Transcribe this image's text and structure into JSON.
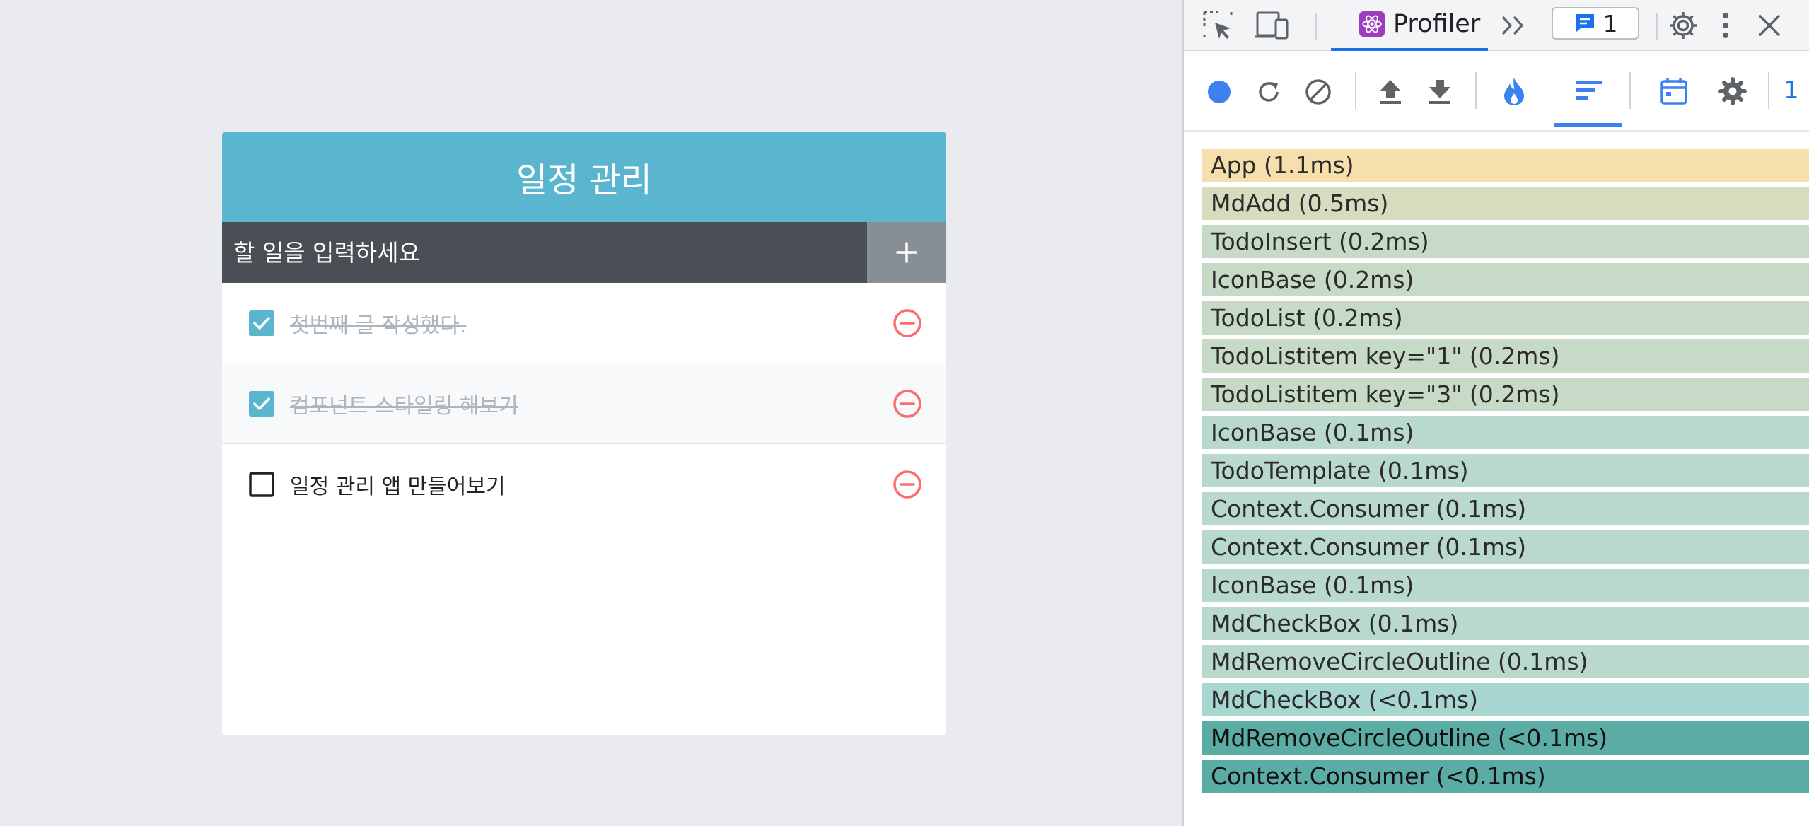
{
  "app": {
    "title": "일정 관리",
    "input_placeholder": "할 일을 입력하세요",
    "add_icon": "plus-icon",
    "todos": [
      {
        "text": "첫번째 글 작성했다.",
        "checked": true
      },
      {
        "text": "컴포넌트 스타일링 해보기",
        "checked": true
      },
      {
        "text": "일정 관리 앱 만들어보기",
        "checked": false
      }
    ],
    "colors": {
      "header": "#5ab5cf",
      "insert_bg": "#4a4f56",
      "add_button": "#868e96",
      "check": "#5ab5cf",
      "remove": "#ff6b6b"
    }
  },
  "devtools": {
    "active_tab": "Profiler",
    "issues_count": "1",
    "toolbar_overflow_label": "1",
    "icons": [
      "inspect-element-icon",
      "device-toggle-icon",
      "react-logo-icon",
      "more-tabs-icon",
      "issues-icon",
      "settings-icon",
      "kebab-menu-icon",
      "close-icon"
    ],
    "profiler_toolbar_icons": [
      "record-icon",
      "reload-and-profile-icon",
      "clear-icon",
      "upload-icon",
      "download-icon",
      "flamegraph-icon",
      "ranked-chart-icon",
      "timeline-icon",
      "profiler-settings-icon"
    ],
    "ranked_rows": [
      {
        "label": "App (1.1ms)",
        "color": "#f7dfad"
      },
      {
        "label": "MdAdd (0.5ms)",
        "color": "#d8dcbf"
      },
      {
        "label": "TodoInsert (0.2ms)",
        "color": "#c7dac7"
      },
      {
        "label": "IconBase (0.2ms)",
        "color": "#c7dac7"
      },
      {
        "label": "TodoList (0.2ms)",
        "color": "#c7dac7"
      },
      {
        "label": "TodoListitem key=\"1\" (0.2ms)",
        "color": "#c7dac7"
      },
      {
        "label": "TodoListitem key=\"3\" (0.2ms)",
        "color": "#c7dac7"
      },
      {
        "label": "IconBase (0.1ms)",
        "color": "#bad9cd"
      },
      {
        "label": "TodoTemplate (0.1ms)",
        "color": "#bad9cd"
      },
      {
        "label": "Context.Consumer (0.1ms)",
        "color": "#bad9cd"
      },
      {
        "label": "Context.Consumer (0.1ms)",
        "color": "#bad9cd"
      },
      {
        "label": "IconBase (0.1ms)",
        "color": "#bad9cd"
      },
      {
        "label": "MdCheckBox (0.1ms)",
        "color": "#bad9cd"
      },
      {
        "label": "MdRemoveCircleOutline (0.1ms)",
        "color": "#bad9cd"
      },
      {
        "label": "MdCheckBox (<0.1ms)",
        "color": "#a7d7d0"
      },
      {
        "label": "MdRemoveCircleOutline (<0.1ms)",
        "color": "#5aaca4"
      },
      {
        "label": "Context.Consumer (<0.1ms)",
        "color": "#5aaca4"
      }
    ]
  }
}
